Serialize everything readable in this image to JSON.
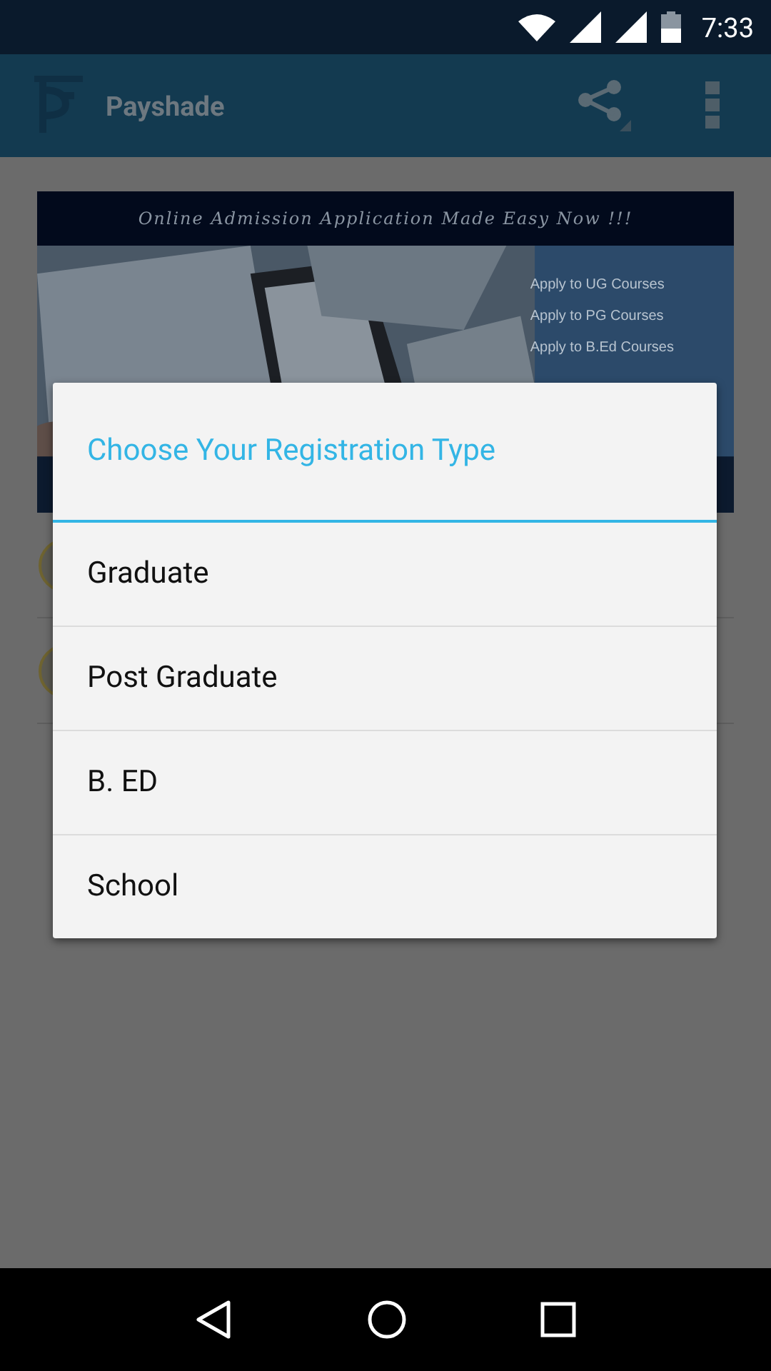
{
  "status_bar": {
    "time": "7:33"
  },
  "app_bar": {
    "title": "Payshade"
  },
  "banner": {
    "heading": "Online Admission Application Made Easy Now !!!",
    "links": [
      "Apply to UG Courses",
      "Apply to PG Courses",
      "Apply to B.Ed Courses"
    ]
  },
  "list_rows": [
    {
      "kind": "avatar"
    },
    {
      "kind": "avatar"
    }
  ],
  "dialog": {
    "title": "Choose Your Registration Type",
    "options": [
      {
        "label": "Graduate"
      },
      {
        "label": "Post Graduate"
      },
      {
        "label": "B. ED"
      },
      {
        "label": "School"
      }
    ]
  }
}
